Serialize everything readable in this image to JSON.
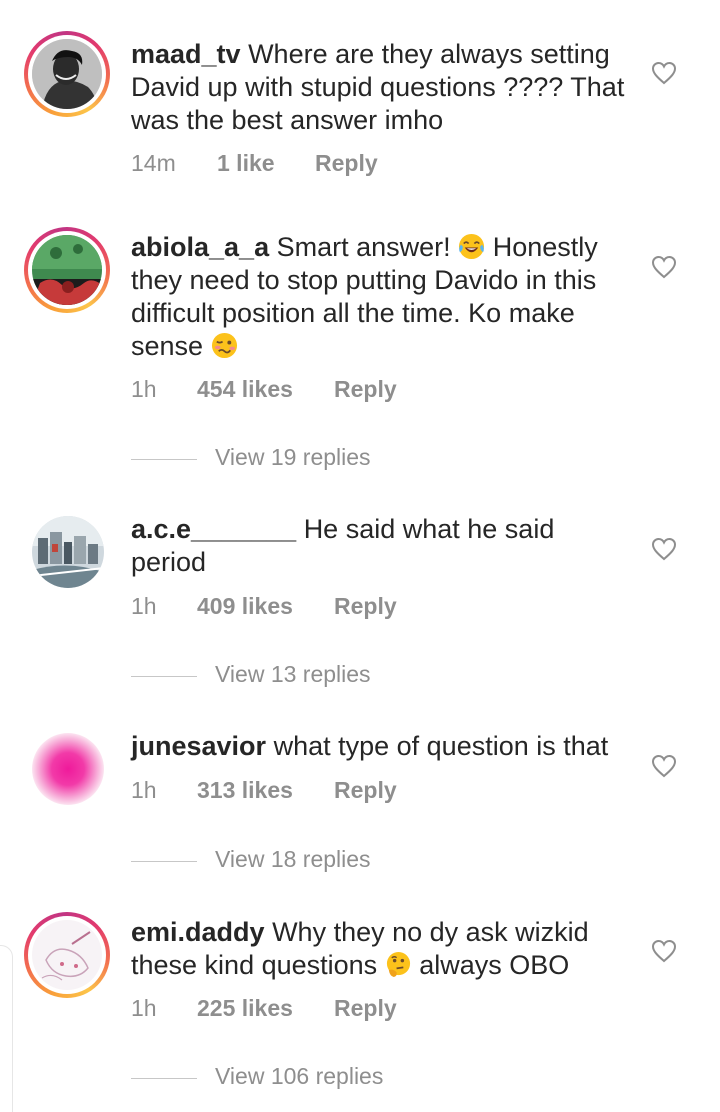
{
  "comments": [
    {
      "username": "maad_tv",
      "text": "Where are they always setting David up with stupid questions ???? That was the best answer imho",
      "time": "14m",
      "likes": "1 like",
      "reply": "Reply",
      "avatar_icon": "profile-photo-man",
      "has_story_ring": true
    },
    {
      "username": "abiola_a_a",
      "text_part1": "Smart answer!",
      "emoji1": "face-with-tears-of-joy",
      "text_part2": "Honestly they need to stop putting Davido in this difficult position all the time. Ko make sense",
      "emoji2": "woozy-face",
      "time": "1h",
      "likes": "454 likes",
      "reply": "Reply",
      "view_replies": "View 19 replies",
      "avatar_icon": "profile-photo-green",
      "has_story_ring": true
    },
    {
      "username": "a.c.e_______",
      "text": "He said what he said period",
      "time": "1h",
      "likes": "409 likes",
      "reply": "Reply",
      "view_replies": "View 13 replies",
      "avatar_icon": "profile-photo-city",
      "has_story_ring": false
    },
    {
      "username": "junesavior",
      "text": "what type of question is that",
      "time": "1h",
      "likes": "313 likes",
      "reply": "Reply",
      "view_replies": "View 18 replies",
      "avatar_icon": "profile-photo-pink",
      "has_story_ring": false
    },
    {
      "username": "emi.daddy",
      "text_part1": "Why they no dy ask wizkid these kind questions",
      "emoji1": "thinking-face",
      "text_part2": "always OBO",
      "time": "1h",
      "likes": "225 likes",
      "reply": "Reply",
      "view_replies": "View 106 replies",
      "avatar_icon": "profile-photo-sketch",
      "has_story_ring": true
    }
  ],
  "colors": {
    "text": "#262626",
    "secondary": "#8e8e8e",
    "divider": "#c7c7c7"
  }
}
